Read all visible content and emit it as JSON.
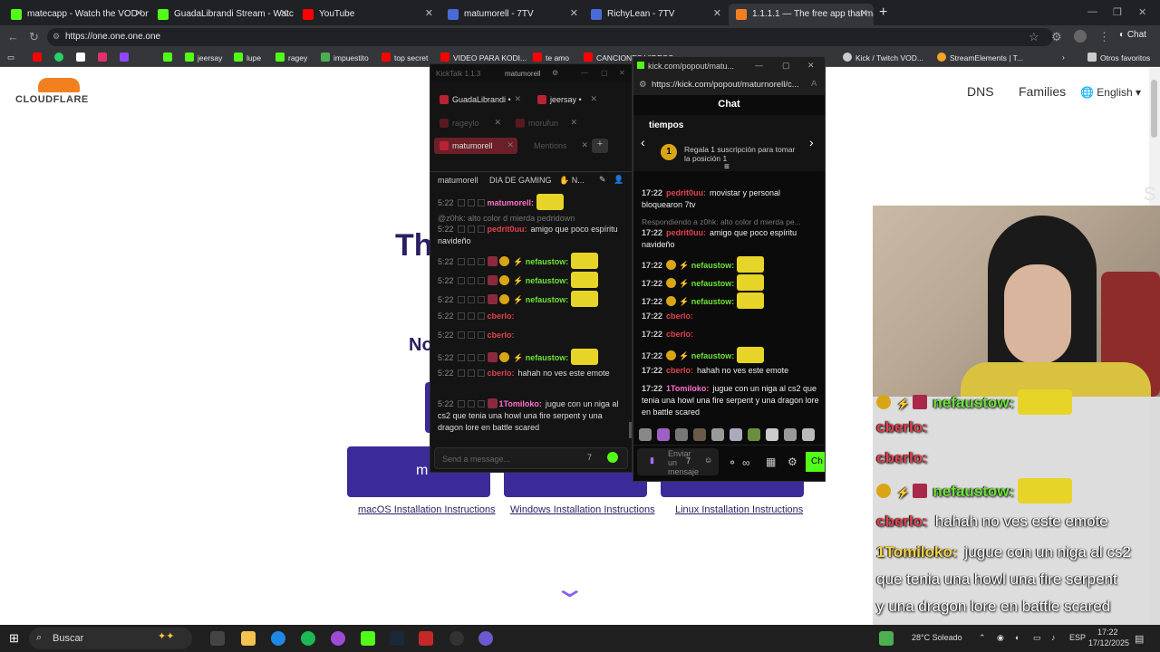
{
  "browser": {
    "tabs": [
      {
        "title": "matecapp - Watch the VOD on Ki",
        "color": "#53fc18"
      },
      {
        "title": "GuadaLibrandi Stream - Watc",
        "color": "#53fc18"
      },
      {
        "title": "YouTube",
        "color": "#ff0000"
      },
      {
        "title": "matumorell - 7TV",
        "color": "#4a6bd6"
      },
      {
        "title": "RichyLean - 7TV",
        "color": "#4a6bd6"
      },
      {
        "title": "1.1.1.1 — The free app that makes",
        "color": "#f38020"
      }
    ],
    "url": "https://one.one.one.one",
    "bookmarks": [
      {
        "label": "",
        "color": "#ff0000"
      },
      {
        "label": "",
        "color": "#25d366"
      },
      {
        "label": "",
        "color": "#ffffff"
      },
      {
        "label": "",
        "color": "#e1306c"
      },
      {
        "label": "",
        "color": "#9146ff"
      },
      {
        "label": "",
        "color": "#53fc18"
      },
      {
        "label": "jeersay",
        "color": "#53fc18"
      },
      {
        "label": "lupe",
        "color": "#53fc18"
      },
      {
        "label": "ragey",
        "color": "#53fc18"
      },
      {
        "label": "impuestito",
        "color": "#4caf50"
      },
      {
        "label": "top secret",
        "color": "#ff0000"
      },
      {
        "label": "VIDEO PARA KODI...",
        "color": "#ff0000"
      },
      {
        "label": "te amo",
        "color": "#ff0000"
      },
      {
        "label": "CANCIONES VIDEOS",
        "color": "#ff0000"
      },
      {
        "label": "Kick / Twitch VOD...",
        "color": "#cccccc"
      },
      {
        "label": "StreamElements | T...",
        "color": "#f5a623"
      },
      {
        "label": "Otros favoritos",
        "color": "#cccccc"
      }
    ]
  },
  "cloudflare": {
    "logo": "CLOUDFLARE",
    "nav": [
      "DNS",
      "Families",
      "English"
    ],
    "title_partial": "Th",
    "subtitle_partial": "No",
    "buttons": [
      {
        "label_partial": "m",
        "icon": "apple-icon"
      },
      {
        "label_partial": "",
        "icon": "windows-icon"
      },
      {
        "label_partial": "",
        "icon": "linux-icon"
      }
    ],
    "links": [
      "macOS Installation Instructions",
      "Windows Installation Instructions",
      "Linux Installation Instructions"
    ]
  },
  "kicktalk": {
    "title": "KickTalk 1.1.3",
    "active_channel": "matumorell",
    "tabs": [
      {
        "name": "GuadaLibrandi",
        "dim": false
      },
      {
        "name": "jeersay",
        "dim": false
      },
      {
        "name": "rageylo",
        "dim": true
      },
      {
        "name": "morufun",
        "dim": true
      },
      {
        "name": "matumorell",
        "dim": false
      },
      {
        "name": "Mentions",
        "dim": true
      }
    ],
    "header": {
      "channel": "matumorell",
      "title": "DIA DE GAMING",
      "extra": "N..."
    },
    "messages": [
      {
        "time": "5:22",
        "user": "matumorell:",
        "ucls": "u-pink",
        "text": "",
        "emote": true,
        "badges": ""
      },
      {
        "time": "",
        "user": "",
        "ucls": "",
        "text": "@z0hk: alto color d mierda pedridown",
        "emote": false,
        "badges": "reply"
      },
      {
        "time": "5:22",
        "user": "pedrit0uu:",
        "ucls": "u-red",
        "text": "amigo que poco espíritu navideño",
        "emote": false,
        "badges": ""
      },
      {
        "time": "5:22",
        "user": "nefaustow:",
        "ucls": "u-green",
        "text": "",
        "emote": true,
        "badges": "71"
      },
      {
        "time": "5:22",
        "user": "nefaustow:",
        "ucls": "u-green",
        "text": "",
        "emote": true,
        "badges": "71"
      },
      {
        "time": "5:22",
        "user": "nefaustow:",
        "ucls": "u-green",
        "text": "",
        "emote": true,
        "badges": "71"
      },
      {
        "time": "5:22",
        "user": "cberlo:",
        "ucls": "u-red",
        "text": "",
        "emote": false,
        "badges": ""
      },
      {
        "time": "5:22",
        "user": "cberlo:",
        "ucls": "u-red",
        "text": "",
        "emote": false,
        "badges": ""
      },
      {
        "time": "5:22",
        "user": "nefaustow:",
        "ucls": "u-green",
        "text": "",
        "emote": true,
        "badges": "71"
      },
      {
        "time": "5:22",
        "user": "cberlo:",
        "ucls": "u-red",
        "text": "hahah no ves este emote",
        "emote": false,
        "badges": ""
      },
      {
        "time": "5:22",
        "user": "1Tomiloko:",
        "ucls": "u-pink",
        "text": "jugue con un niga al cs2 que tenia una howl una fire serpent y una dragon lore en battle scared",
        "emote": false,
        "badges": "7"
      }
    ],
    "input_placeholder": "Send a message..."
  },
  "kick": {
    "window_title": "kick.com/popout/matu...",
    "url": "https://kick.com/popout/maturnorell/c...",
    "chat_label": "Chat",
    "banner_top": "tiempos",
    "banner_text": "Regala 1 suscripción para tomar la posición 1",
    "messages": [
      {
        "time": "17:22",
        "user": "pedrit0uu:",
        "ucls": "u-red",
        "text": "movistar y personal bloquearon 7tv",
        "emote": false,
        "badge": false
      },
      {
        "time": "",
        "user": "",
        "ucls": "",
        "text": "Respondiendo a z0hk: alto color d mierda pe...",
        "emote": false,
        "badge": false,
        "reply": true
      },
      {
        "time": "17:22",
        "user": "pedrit0uu:",
        "ucls": "u-red",
        "text": "amigo que poco espíritu navideño",
        "emote": false,
        "badge": false
      },
      {
        "time": "17:22",
        "user": "nefaustow:",
        "ucls": "u-green",
        "text": "",
        "emote": true,
        "badge": true
      },
      {
        "time": "17:22",
        "user": "nefaustow:",
        "ucls": "u-green",
        "text": "",
        "emote": true,
        "badge": true
      },
      {
        "time": "17:22",
        "user": "nefaustow:",
        "ucls": "u-green",
        "text": "",
        "emote": true,
        "badge": true
      },
      {
        "time": "17:22",
        "user": "cberlo:",
        "ucls": "u-red",
        "text": "",
        "emote": false,
        "badge": false
      },
      {
        "time": "17:22",
        "user": "cberlo:",
        "ucls": "u-red",
        "text": "",
        "emote": false,
        "badge": false
      },
      {
        "time": "17:22",
        "user": "nefaustow:",
        "ucls": "u-green",
        "text": "",
        "emote": true,
        "badge": true
      },
      {
        "time": "17:22",
        "user": "cberlo:",
        "ucls": "u-red",
        "text": "hahah no ves este emote",
        "emote": false,
        "badge": false
      },
      {
        "time": "17:22",
        "user": "1Tomiloko:",
        "ucls": "u-pink",
        "text": "jugue con un niga al cs2 que tenia una howl una fire serpent y una dragon lore en battle scared",
        "emote": false,
        "badge": false
      }
    ],
    "send_placeholder": "Enviar un mensaje",
    "chat_button": "Ch"
  },
  "overlay": {
    "faded": "s",
    "lines": [
      {
        "user": "nefaustow:",
        "color": "#6ee23a",
        "text": "",
        "emote": true,
        "badges": true
      },
      {
        "user": "cberlo:",
        "color": "#e0424e",
        "text": "",
        "emote": false,
        "badges": false
      },
      {
        "user": "cberlo:",
        "color": "#e0424e",
        "text": "",
        "emote": false,
        "badges": false
      },
      {
        "user": "nefaustow:",
        "color": "#6ee23a",
        "text": "",
        "emote": true,
        "badges": true
      },
      {
        "user": "cberlo:",
        "color": "#e0424e",
        "text": "hahah no ves este emote",
        "emote": false,
        "badges": false
      },
      {
        "user": "1Tomiloko:",
        "color": "#f5d142",
        "text": "jugue con un niga al cs2",
        "emote": false,
        "badges": false
      },
      {
        "user": "",
        "color": "#ffffff",
        "text": "que tenia una howl una fire serpent",
        "emote": false,
        "badges": false
      },
      {
        "user": "",
        "color": "#ffffff",
        "text": "y una dragon lore en battle scared",
        "emote": false,
        "badges": false
      }
    ]
  },
  "taskbar": {
    "search": "Buscar",
    "weather": "28°C Soleado",
    "lang": "ESP",
    "time": "17:22",
    "date": "17/12/2025"
  }
}
